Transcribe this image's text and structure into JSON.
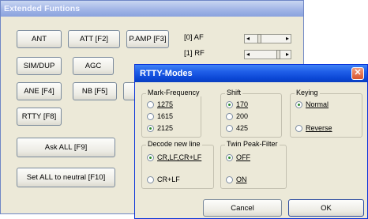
{
  "main": {
    "title": "Extended Funtions",
    "buttons": {
      "ant": "ANT",
      "att": "ATT [F2]",
      "pamp": "P.AMP [F3]",
      "simdup": "SIM/DUP",
      "agc": "AGC",
      "ane": "ANE [F4]",
      "nb": "NB [F5]",
      "rtty": "RTTY [F8]",
      "askall": "Ask ALL [F9]",
      "setall": "Set ALL to neutral [F10]"
    },
    "sliders": {
      "af_label": "[0] AF",
      "rf_label": "[1] RF"
    }
  },
  "dialog": {
    "title": "RTTY-Modes",
    "close_glyph": "✕",
    "mark": {
      "title": "Mark-Frequency",
      "options": [
        "1275",
        "1615",
        "2125"
      ],
      "selected": "2125"
    },
    "shift": {
      "title": "Shift",
      "options": [
        "170",
        "200",
        "425"
      ],
      "selected": "170"
    },
    "keying": {
      "title": "Keying",
      "options": [
        "Normal",
        "Reverse"
      ],
      "selected": "Normal"
    },
    "decode": {
      "title": "Decode new line",
      "options": [
        "CR,LF,CR+LF",
        "CR+LF"
      ],
      "selected": "CR,LF,CR+LF"
    },
    "twinpeak": {
      "title": "Twin Peak-Filter",
      "options": [
        "OFF",
        "ON"
      ],
      "selected": "OFF"
    },
    "cancel": "Cancel",
    "ok": "OK"
  }
}
